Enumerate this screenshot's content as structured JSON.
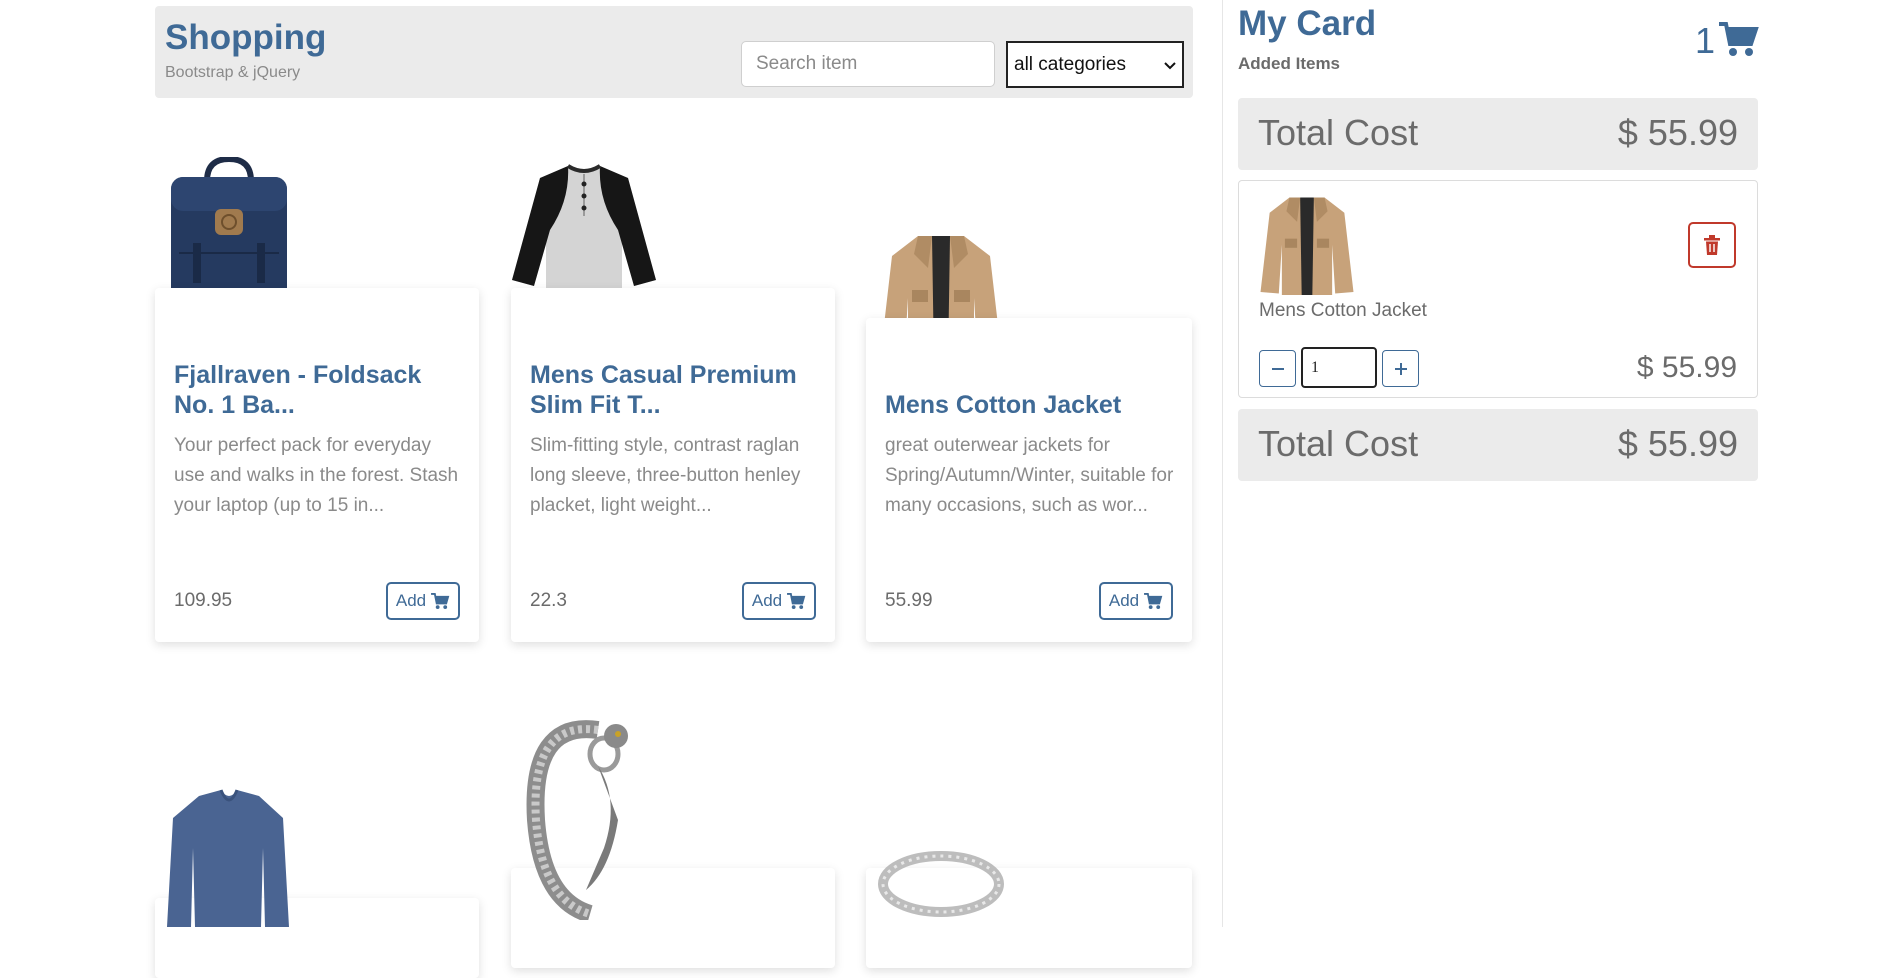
{
  "header": {
    "title": "Shopping",
    "subtitle": "Bootstrap & jQuery",
    "search_placeholder": "Search item",
    "category_selected": "all categories"
  },
  "products": [
    {
      "title": "Fjallraven - Foldsack No. 1 Ba...",
      "description": "Your perfect pack for everyday use and walks in the forest. Stash your laptop (up to 15 in...",
      "price": "109.95",
      "add_label": "Add"
    },
    {
      "title": "Mens Casual Premium Slim Fit T...",
      "description": "Slim-fitting style, contrast raglan long sleeve, three-button henley placket, light weight...",
      "price": "22.3",
      "add_label": "Add"
    },
    {
      "title": "Mens Cotton Jacket",
      "description": "great outerwear jackets for Spring/Autumn/Winter, suitable for many occasions, such as wor...",
      "price": "55.99",
      "add_label": "Add"
    }
  ],
  "cart": {
    "title": "My Card",
    "subtitle": "Added Items",
    "count": "1",
    "total_label": "Total Cost",
    "total_value": "$ 55.99",
    "items": [
      {
        "name": "Mens Cotton Jacket",
        "quantity": "1",
        "price": "$ 55.99"
      }
    ]
  },
  "colors": {
    "accent": "#3f6a96",
    "panel": "#ebebeb",
    "danger": "#c0392b"
  },
  "icons": [
    "shopping-cart-icon",
    "trash-icon",
    "minus-icon",
    "plus-icon",
    "chevron-down-icon"
  ]
}
